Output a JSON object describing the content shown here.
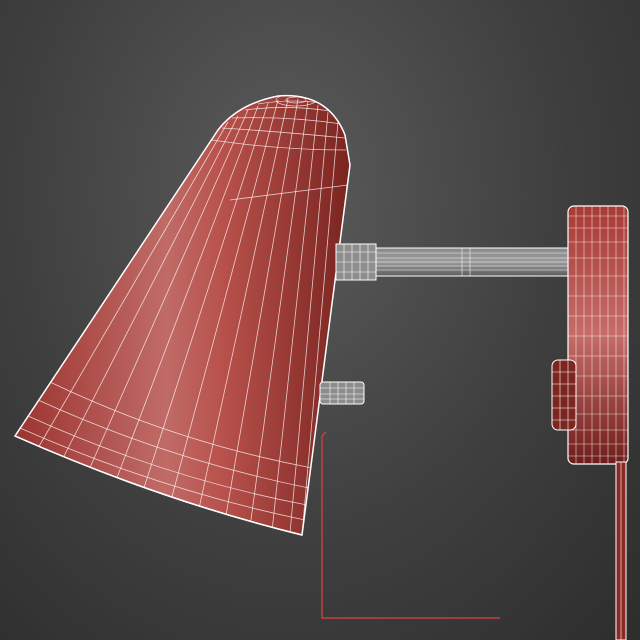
{
  "scene": {
    "subject": "wall-lamp-wireframe-render",
    "colors": {
      "background_light": "#5b5b5b",
      "background_dark": "#2d2d2d",
      "shade_red": "#b5403a",
      "shade_dark": "#7a2420",
      "shade_highlight": "#d98a86",
      "wire_white": "#ffffff",
      "gizmo_red": "#c24141"
    }
  }
}
